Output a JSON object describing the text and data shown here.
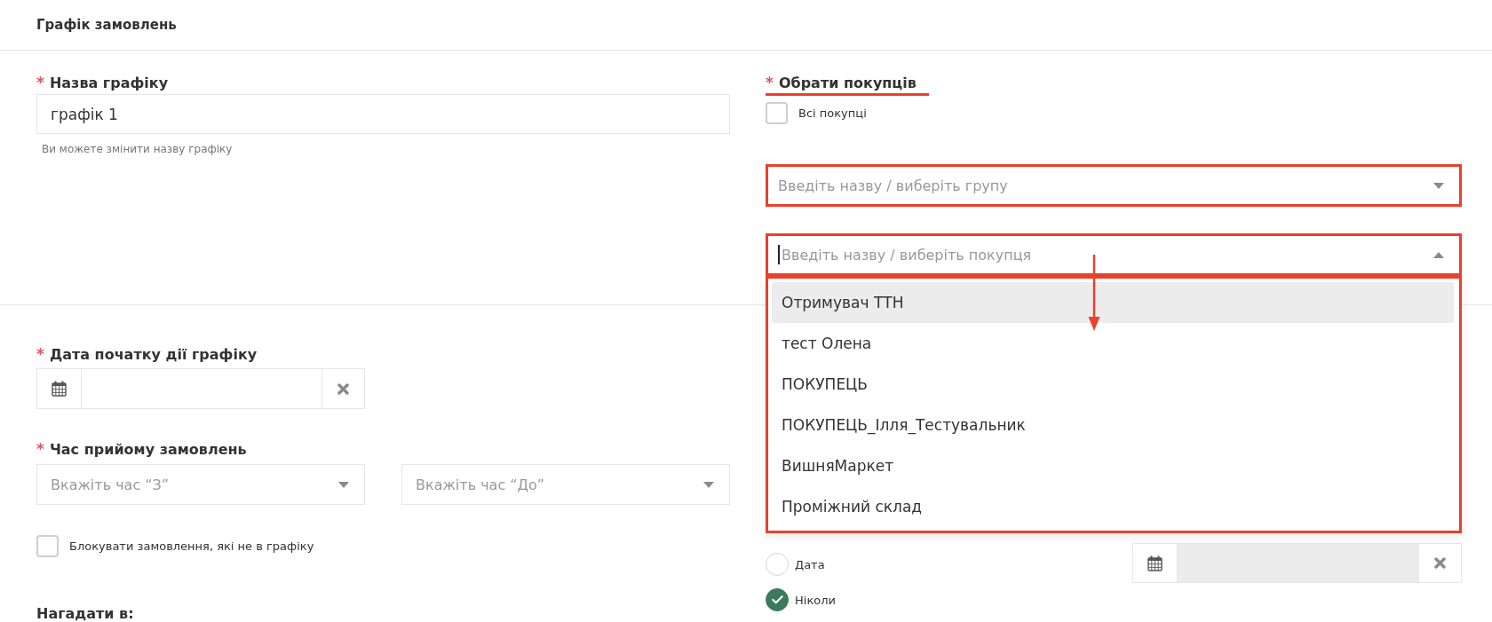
{
  "header": {
    "title": "Графік замовлень"
  },
  "schedule_name": {
    "required_mark": "*",
    "label": "Назва графіку",
    "value": "графік 1",
    "hint": "Ви можете змінити назву графіку"
  },
  "buyers": {
    "required_mark": "*",
    "label": "Обрати покупців",
    "underlined": true,
    "all_buyers": {
      "label": "Всі покупці",
      "checked": false
    },
    "group_select": {
      "placeholder": "Введіть назву / виберіть групу",
      "highlighted": true,
      "expanded": false
    },
    "buyer_select": {
      "placeholder": "Введіть назву / виберіть покупця",
      "highlighted": true,
      "expanded": true,
      "focused": true,
      "pointer_arrow": true,
      "menu": {
        "highlighted": true,
        "options": [
          {
            "label": "Отримувач ТТН",
            "selected": true
          },
          {
            "label": "тест Олена",
            "selected": false
          },
          {
            "label": "ПОКУПЕЦЬ",
            "selected": false
          },
          {
            "label": "ПОКУПЕЦЬ_Ілля_Тестувальник",
            "selected": false
          },
          {
            "label": "ВишняМаркет",
            "selected": false
          },
          {
            "label": "Проміжний склад",
            "selected": false
          }
        ]
      }
    }
  },
  "start_date": {
    "required_mark": "*",
    "label": "Дата початку дії графіку",
    "field": {
      "disabled": false
    }
  },
  "order_time": {
    "required_mark": "*",
    "label": "Час прийому замовлень",
    "from": {
      "placeholder": "Вкажіть час “З”",
      "expanded": false
    },
    "to": {
      "placeholder": "Вкажіть час “До”",
      "expanded": false
    }
  },
  "block_orders": {
    "label": "Блокувати замовлення, які не в графіку",
    "checked": false
  },
  "end_date": {
    "options": [
      {
        "label": "Дата",
        "selected": false
      },
      {
        "label": "Ніколи",
        "selected": true
      }
    ],
    "field": {
      "disabled": true
    }
  },
  "remind": {
    "label": "Нагадати в:"
  }
}
